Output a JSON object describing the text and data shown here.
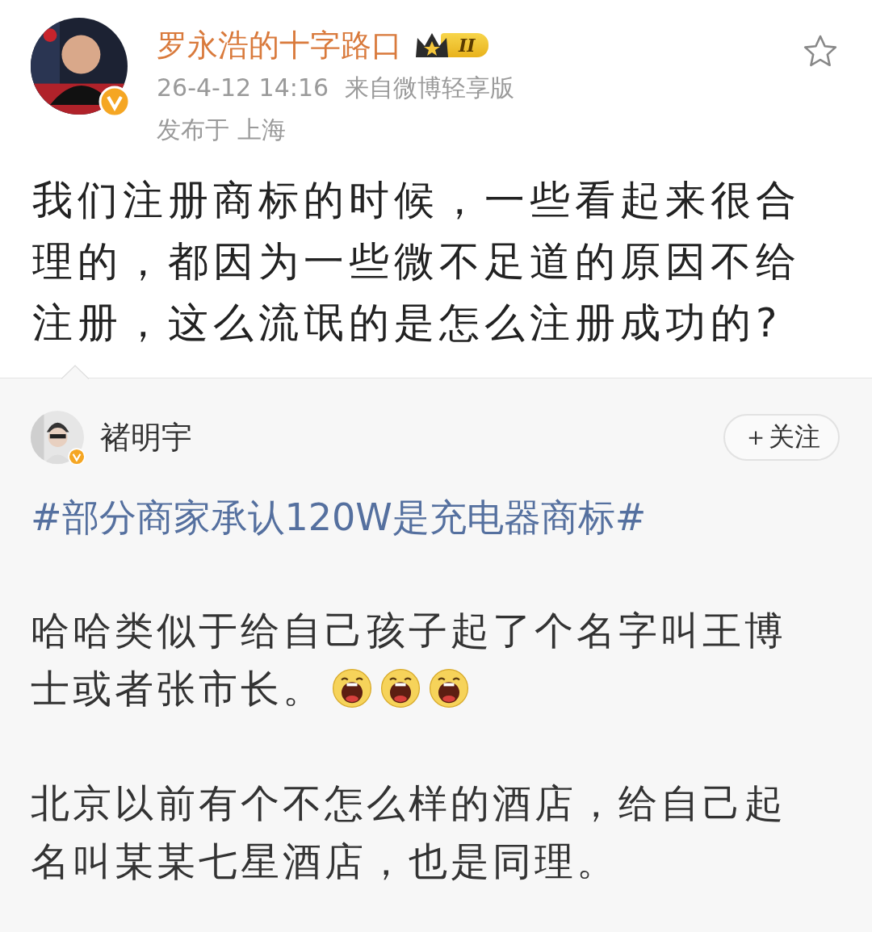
{
  "post": {
    "author": {
      "name": "罗永浩的十字路口",
      "verified": true,
      "badge_level": "II"
    },
    "time": "26-4-12 14:16",
    "source": "来自微博轻享版",
    "location": "发布于 上海",
    "text": "我们注册商标的时候，一些看起来很合理的，都因为一些微不足道的原因不给注册，这么流氓的是怎么注册成功的?"
  },
  "repost": {
    "author": {
      "name": "褚明宇",
      "verified": true
    },
    "follow_button": "＋关注",
    "topic": "#部分商家承认120W是充电器商标#",
    "paragraphs": [
      {
        "lines": [
          "哈哈类似于给自己孩子起了个名字叫王博",
          "士或者张市长。"
        ],
        "emojis": [
          {
            "kind": "laugh"
          },
          {
            "kind": "laugh"
          },
          {
            "kind": "laugh"
          }
        ]
      },
      {
        "lines": [
          "北京以前有个不怎么样的酒店，给自己起",
          "名叫某某七星酒店，也是同理。"
        ]
      }
    ]
  }
}
